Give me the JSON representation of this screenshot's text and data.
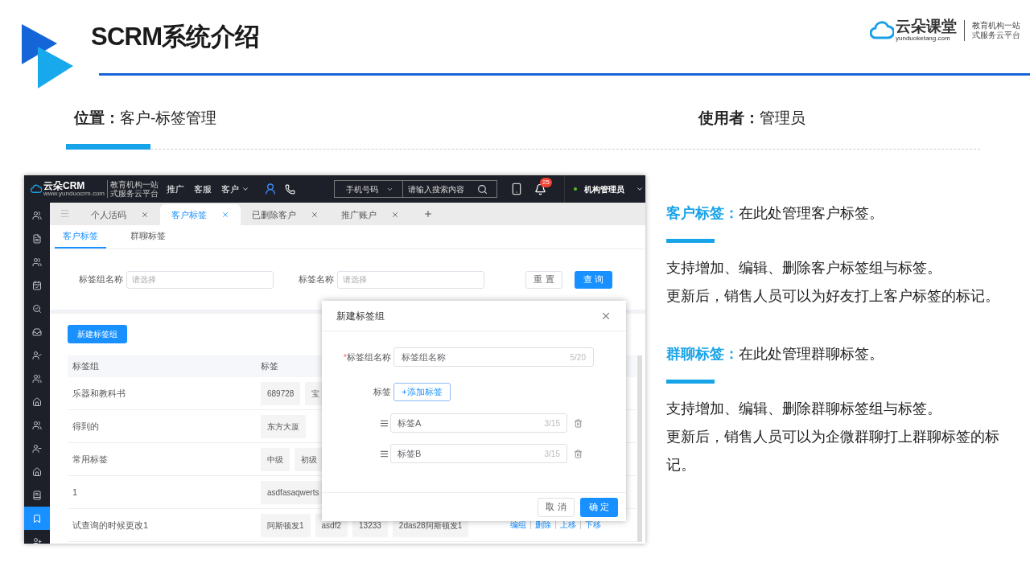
{
  "slide": {
    "title": "SCRM系统介绍",
    "brand": {
      "name": "云朵课堂",
      "domain": "yunduoketang.com",
      "slogan_lines": [
        "教育机构一站",
        "式服务云平台"
      ]
    }
  },
  "info": {
    "location": {
      "label": "位置：",
      "value": "客户-标签管理"
    },
    "user": {
      "label": "使用者：",
      "value": "管理员"
    }
  },
  "app": {
    "logo": {
      "name": "云朵CRM",
      "domain": "www.yunduocrm.com",
      "slogan_lines": [
        "教育机构一站",
        "式服务云平台"
      ]
    },
    "nav": [
      {
        "label": "推广",
        "menu": false
      },
      {
        "label": "客服",
        "menu": false
      },
      {
        "label": "客户",
        "menu": true
      }
    ],
    "search": {
      "field": "手机号码",
      "placeholder": "请输入搜索内容"
    },
    "notifications": "25",
    "user": "机构管理员",
    "sidebar": [
      {
        "selected": false
      },
      {
        "selected": false
      },
      {
        "selected": false
      },
      {
        "selected": false
      },
      {
        "selected": false
      },
      {
        "selected": false
      },
      {
        "selected": false
      },
      {
        "selected": false
      },
      {
        "selected": false
      },
      {
        "selected": false
      },
      {
        "selected": false
      },
      {
        "selected": false
      },
      {
        "selected": false
      },
      {
        "selected": true
      },
      {
        "selected": false
      }
    ],
    "tabs": [
      {
        "label": "个人活码",
        "selected": false
      },
      {
        "label": "客户标签",
        "selected": true
      },
      {
        "label": "已删除客户",
        "selected": false
      },
      {
        "label": "推广账户",
        "selected": false
      }
    ],
    "subtabs": [
      {
        "label": "客户标签",
        "selected": true
      },
      {
        "label": "群聊标签",
        "selected": false
      }
    ],
    "filters": [
      {
        "label": "标签组名称",
        "placeholder": "请选择"
      },
      {
        "label": "标签名称",
        "placeholder": "请选择"
      }
    ],
    "reset_button": "重 置",
    "query_button": "查 询",
    "new_group_button": "新建标签组",
    "table": {
      "columns": [
        "标签组",
        "标签"
      ],
      "rows": [
        {
          "group": "乐器和教科书",
          "tags": [
            "689728",
            "宝"
          ]
        },
        {
          "group": "得到的",
          "tags": [
            "东方大厦"
          ]
        },
        {
          "group": "常用标签",
          "tags": [
            "中级",
            "初级"
          ]
        },
        {
          "group": "1",
          "tags": [
            "asdfasaqwerts"
          ]
        },
        {
          "group": "试查询的时候更改1",
          "tags": [
            "阿斯顿发1",
            "asdf2",
            "13233",
            "2das28阿斯顿发1"
          ],
          "actions": [
            "编组",
            "删除",
            "上移",
            "下移"
          ]
        }
      ]
    },
    "dialog": {
      "title": "新建标签组",
      "name_field": {
        "required_mark": "*",
        "label": "标签组名称",
        "value": "标签组名称",
        "count": "5/20"
      },
      "tags_label": "标签",
      "add_tag_button": "+添加标签",
      "tag_inputs": [
        {
          "value": "标签A",
          "count": "3/15"
        },
        {
          "value": "标签B",
          "count": "3/15"
        }
      ],
      "cancel_button": "取 消",
      "confirm_button": "确 定"
    }
  },
  "notes": [
    {
      "heading": "客户标签：",
      "lead": "在此处管理客户标签。",
      "lines": [
        "支持增加、编辑、删除客户标签组与标签。",
        "更新后，销售人员可以为好友打上客户标签的标记。"
      ]
    },
    {
      "heading": "群聊标签：",
      "lead": "在此处管理群聊标签。",
      "lines": [
        "支持增加、编辑、删除群聊标签组与标签。",
        "更新后，销售人员可以为企微群聊打上群聊标签的标记。"
      ]
    }
  ]
}
